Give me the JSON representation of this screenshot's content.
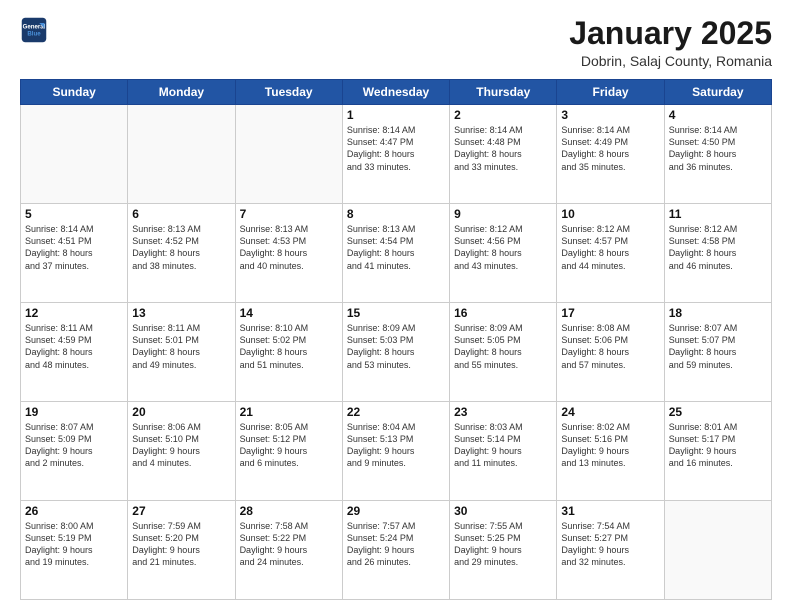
{
  "header": {
    "logo_line1": "General",
    "logo_line2": "Blue",
    "title": "January 2025",
    "subtitle": "Dobrin, Salaj County, Romania"
  },
  "days_of_week": [
    "Sunday",
    "Monday",
    "Tuesday",
    "Wednesday",
    "Thursday",
    "Friday",
    "Saturday"
  ],
  "weeks": [
    [
      {
        "day": "",
        "info": ""
      },
      {
        "day": "",
        "info": ""
      },
      {
        "day": "",
        "info": ""
      },
      {
        "day": "1",
        "info": "Sunrise: 8:14 AM\nSunset: 4:47 PM\nDaylight: 8 hours\nand 33 minutes."
      },
      {
        "day": "2",
        "info": "Sunrise: 8:14 AM\nSunset: 4:48 PM\nDaylight: 8 hours\nand 33 minutes."
      },
      {
        "day": "3",
        "info": "Sunrise: 8:14 AM\nSunset: 4:49 PM\nDaylight: 8 hours\nand 35 minutes."
      },
      {
        "day": "4",
        "info": "Sunrise: 8:14 AM\nSunset: 4:50 PM\nDaylight: 8 hours\nand 36 minutes."
      }
    ],
    [
      {
        "day": "5",
        "info": "Sunrise: 8:14 AM\nSunset: 4:51 PM\nDaylight: 8 hours\nand 37 minutes."
      },
      {
        "day": "6",
        "info": "Sunrise: 8:13 AM\nSunset: 4:52 PM\nDaylight: 8 hours\nand 38 minutes."
      },
      {
        "day": "7",
        "info": "Sunrise: 8:13 AM\nSunset: 4:53 PM\nDaylight: 8 hours\nand 40 minutes."
      },
      {
        "day": "8",
        "info": "Sunrise: 8:13 AM\nSunset: 4:54 PM\nDaylight: 8 hours\nand 41 minutes."
      },
      {
        "day": "9",
        "info": "Sunrise: 8:12 AM\nSunset: 4:56 PM\nDaylight: 8 hours\nand 43 minutes."
      },
      {
        "day": "10",
        "info": "Sunrise: 8:12 AM\nSunset: 4:57 PM\nDaylight: 8 hours\nand 44 minutes."
      },
      {
        "day": "11",
        "info": "Sunrise: 8:12 AM\nSunset: 4:58 PM\nDaylight: 8 hours\nand 46 minutes."
      }
    ],
    [
      {
        "day": "12",
        "info": "Sunrise: 8:11 AM\nSunset: 4:59 PM\nDaylight: 8 hours\nand 48 minutes."
      },
      {
        "day": "13",
        "info": "Sunrise: 8:11 AM\nSunset: 5:01 PM\nDaylight: 8 hours\nand 49 minutes."
      },
      {
        "day": "14",
        "info": "Sunrise: 8:10 AM\nSunset: 5:02 PM\nDaylight: 8 hours\nand 51 minutes."
      },
      {
        "day": "15",
        "info": "Sunrise: 8:09 AM\nSunset: 5:03 PM\nDaylight: 8 hours\nand 53 minutes."
      },
      {
        "day": "16",
        "info": "Sunrise: 8:09 AM\nSunset: 5:05 PM\nDaylight: 8 hours\nand 55 minutes."
      },
      {
        "day": "17",
        "info": "Sunrise: 8:08 AM\nSunset: 5:06 PM\nDaylight: 8 hours\nand 57 minutes."
      },
      {
        "day": "18",
        "info": "Sunrise: 8:07 AM\nSunset: 5:07 PM\nDaylight: 8 hours\nand 59 minutes."
      }
    ],
    [
      {
        "day": "19",
        "info": "Sunrise: 8:07 AM\nSunset: 5:09 PM\nDaylight: 9 hours\nand 2 minutes."
      },
      {
        "day": "20",
        "info": "Sunrise: 8:06 AM\nSunset: 5:10 PM\nDaylight: 9 hours\nand 4 minutes."
      },
      {
        "day": "21",
        "info": "Sunrise: 8:05 AM\nSunset: 5:12 PM\nDaylight: 9 hours\nand 6 minutes."
      },
      {
        "day": "22",
        "info": "Sunrise: 8:04 AM\nSunset: 5:13 PM\nDaylight: 9 hours\nand 9 minutes."
      },
      {
        "day": "23",
        "info": "Sunrise: 8:03 AM\nSunset: 5:14 PM\nDaylight: 9 hours\nand 11 minutes."
      },
      {
        "day": "24",
        "info": "Sunrise: 8:02 AM\nSunset: 5:16 PM\nDaylight: 9 hours\nand 13 minutes."
      },
      {
        "day": "25",
        "info": "Sunrise: 8:01 AM\nSunset: 5:17 PM\nDaylight: 9 hours\nand 16 minutes."
      }
    ],
    [
      {
        "day": "26",
        "info": "Sunrise: 8:00 AM\nSunset: 5:19 PM\nDaylight: 9 hours\nand 19 minutes."
      },
      {
        "day": "27",
        "info": "Sunrise: 7:59 AM\nSunset: 5:20 PM\nDaylight: 9 hours\nand 21 minutes."
      },
      {
        "day": "28",
        "info": "Sunrise: 7:58 AM\nSunset: 5:22 PM\nDaylight: 9 hours\nand 24 minutes."
      },
      {
        "day": "29",
        "info": "Sunrise: 7:57 AM\nSunset: 5:24 PM\nDaylight: 9 hours\nand 26 minutes."
      },
      {
        "day": "30",
        "info": "Sunrise: 7:55 AM\nSunset: 5:25 PM\nDaylight: 9 hours\nand 29 minutes."
      },
      {
        "day": "31",
        "info": "Sunrise: 7:54 AM\nSunset: 5:27 PM\nDaylight: 9 hours\nand 32 minutes."
      },
      {
        "day": "",
        "info": ""
      }
    ]
  ]
}
